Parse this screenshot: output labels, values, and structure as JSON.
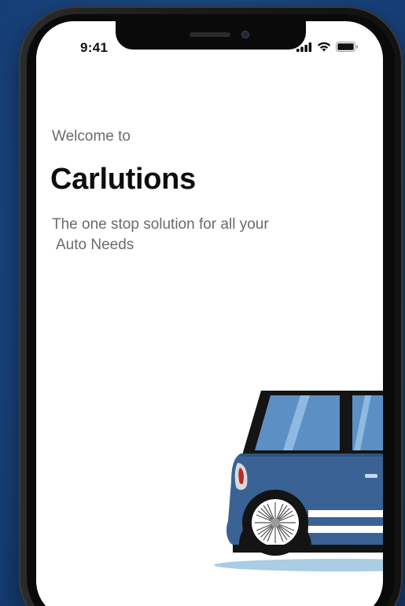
{
  "status_bar": {
    "time": "9:41",
    "icons": [
      "cellular-signal-icon",
      "wifi-icon",
      "battery-icon"
    ]
  },
  "splash": {
    "welcome": "Welcome to",
    "title": "Carlutions",
    "tagline_line1": "The one stop solution for all your",
    "tagline_line2": "Auto Needs"
  },
  "illustration": "car-illustration",
  "colors": {
    "background": "#1a4681",
    "car_body": "#3a6294",
    "car_window": "#5c8fc4",
    "car_shadow": "#a9cde3",
    "text_primary": "#0d0d0d",
    "text_secondary": "#6b6b6b"
  }
}
